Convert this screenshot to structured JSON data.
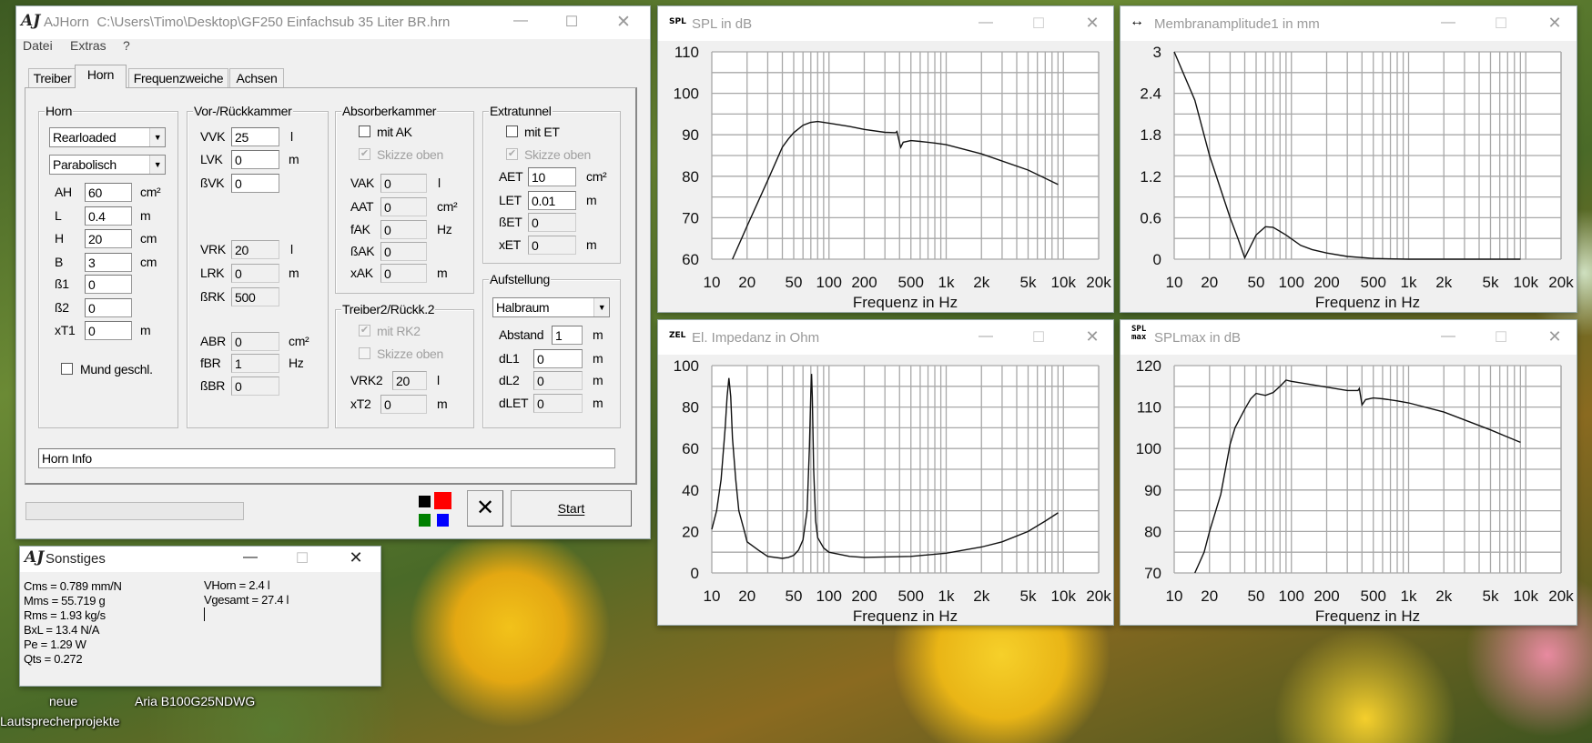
{
  "desktop_icons": [
    "neue",
    "Lautsprecherprojekte",
    "Aria B100G25NDWG"
  ],
  "main": {
    "title": "AJHorn  C:\\Users\\Timo\\Desktop\\GF250 Einfachsub 35 Liter BR.hrn",
    "logo": "AJ",
    "menu": [
      "Datei",
      "Extras",
      "?"
    ],
    "tabs": [
      "Treiber",
      "Horn",
      "Frequenzweiche",
      "Achsen"
    ],
    "active_tab": "Horn",
    "horn": {
      "title": "Horn",
      "type": "Rearloaded",
      "profile": "Parabolisch",
      "fields": [
        {
          "label": "AH",
          "value": "60",
          "unit": "cm²"
        },
        {
          "label": "L",
          "value": "0.4",
          "unit": "m"
        },
        {
          "label": "H",
          "value": "20",
          "unit": "cm"
        },
        {
          "label": "B",
          "value": "3",
          "unit": "cm"
        },
        {
          "label": "ß1",
          "value": "0",
          "unit": ""
        },
        {
          "label": "ß2",
          "value": "0",
          "unit": ""
        },
        {
          "label": "xT1",
          "value": "0",
          "unit": "m"
        }
      ],
      "mund_label": "Mund geschl.",
      "mund_checked": false
    },
    "vor": {
      "title": "Vor-/Rückkammer",
      "fields": [
        {
          "label": "VVK",
          "value": "25",
          "unit": "l"
        },
        {
          "label": "LVK",
          "value": "0",
          "unit": "m"
        },
        {
          "label": "ßVK",
          "value": "0",
          "unit": ""
        },
        {
          "label": "VRK",
          "value": "20",
          "unit": "l"
        },
        {
          "label": "LRK",
          "value": "0",
          "unit": "m"
        },
        {
          "label": "ßRK",
          "value": "500",
          "unit": ""
        },
        {
          "label": "ABR",
          "value": "0",
          "unit": "cm²"
        },
        {
          "label": "fBR",
          "value": "1",
          "unit": "Hz"
        },
        {
          "label": "ßBR",
          "value": "0",
          "unit": ""
        }
      ]
    },
    "absorber": {
      "title": "Absorberkammer",
      "check1": "mit AK",
      "check1_checked": false,
      "check2": "Skizze oben",
      "check2_checked": true,
      "fields": [
        {
          "label": "VAK",
          "value": "0",
          "unit": "l"
        },
        {
          "label": "AAT",
          "value": "0",
          "unit": "cm²"
        },
        {
          "label": "fAK",
          "value": "0",
          "unit": "Hz"
        },
        {
          "label": "ßAK",
          "value": "0",
          "unit": ""
        },
        {
          "label": "xAK",
          "value": "0",
          "unit": "m"
        }
      ]
    },
    "treiber2": {
      "title": "Treiber2/Rückk.2",
      "check1": "mit RK2",
      "check1_checked": true,
      "check2": "Skizze oben",
      "check2_checked": false,
      "fields": [
        {
          "label": "VRK2",
          "value": "20",
          "unit": "l"
        },
        {
          "label": "xT2",
          "value": "0",
          "unit": "m"
        }
      ]
    },
    "extratunnel": {
      "title": "Extratunnel",
      "check1": "mit ET",
      "check1_checked": false,
      "check2": "Skizze oben",
      "check2_checked": true,
      "fields": [
        {
          "label": "AET",
          "value": "10",
          "unit": "cm²"
        },
        {
          "label": "LET",
          "value": "0.01",
          "unit": "m"
        },
        {
          "label": "ßET",
          "value": "0",
          "unit": ""
        },
        {
          "label": "xET",
          "value": "0",
          "unit": "m"
        }
      ]
    },
    "aufstellung": {
      "title": "Aufstellung",
      "mode": "Halbraum",
      "fields": [
        {
          "label": "Abstand",
          "value": "1",
          "unit": "m"
        },
        {
          "label": "dL1",
          "value": "0",
          "unit": "m"
        },
        {
          "label": "dL2",
          "value": "0",
          "unit": "m"
        },
        {
          "label": "dLET",
          "value": "0",
          "unit": "m"
        }
      ]
    },
    "horn_info": "Horn Info",
    "progress": 0,
    "colors": [
      "#000000",
      "#ff0000",
      "#008000",
      "#0000ff"
    ],
    "start_label": "Start",
    "cancel_glyph": "✕"
  },
  "sonstiges": {
    "title": "Sonstiges",
    "left": [
      "Cms = 0.789 mm/N",
      "Mms = 55.719 g",
      "Rms = 1.93 kg/s",
      "BxL = 13.4 N/A",
      "Pe = 1.29 W",
      "Qts = 0.272"
    ],
    "right": [
      "VHorn = 2.4 l",
      "Vgesamt = 27.4 l"
    ]
  },
  "chart_data": [
    {
      "type": "line",
      "title": "SPL in dB",
      "icon": "SPL",
      "xlabel": "Frequenz in Hz",
      "ylabel": "SPL in dB",
      "xscale": "log",
      "xlim": [
        10,
        20000
      ],
      "ylim": [
        60,
        110
      ],
      "ystep": 5,
      "yticks": [
        60,
        70,
        80,
        90,
        100,
        110
      ],
      "ytick_labels": [
        "60",
        "70",
        "80",
        "90",
        "100",
        "110"
      ],
      "xticks": [
        10,
        20,
        50,
        100,
        200,
        500,
        1000,
        2000,
        5000,
        10000,
        20000
      ],
      "xtick_labels": [
        "10",
        "20",
        "50",
        "100",
        "200",
        "500",
        "1k",
        "2k",
        "5k",
        "10k",
        "20k"
      ],
      "grid": true,
      "x": [
        15,
        20,
        30,
        40,
        45,
        50,
        60,
        70,
        80,
        100,
        150,
        200,
        300,
        370,
        380,
        400,
        410,
        430,
        500,
        600,
        800,
        1000,
        2000,
        5000,
        9000
      ],
      "y": [
        60,
        68,
        79,
        87,
        89,
        90.5,
        92.3,
        93,
        93.2,
        92.8,
        92,
        91.3,
        90.6,
        90.5,
        90.8,
        88,
        87,
        88.2,
        88.6,
        88.4,
        88,
        87.6,
        85.4,
        81.5,
        78
      ]
    },
    {
      "type": "line",
      "title": "Membranamplitude1 in mm",
      "icon": "↔",
      "xlabel": "Frequenz in Hz",
      "ylabel": "Membranamplitude in mm",
      "xscale": "log",
      "xlim": [
        10,
        20000
      ],
      "ylim": [
        0,
        3
      ],
      "ystep": 0.3,
      "yticks": [
        0,
        0.6,
        1.2,
        1.8,
        2.4,
        3
      ],
      "ytick_labels": [
        "0",
        "0.6",
        "1.2",
        "1.8",
        "2.4",
        "3"
      ],
      "xticks": [
        10,
        20,
        50,
        100,
        200,
        500,
        1000,
        2000,
        5000,
        10000,
        20000
      ],
      "xtick_labels": [
        "10",
        "20",
        "50",
        "100",
        "200",
        "500",
        "1k",
        "2k",
        "5k",
        "10k",
        "20k"
      ],
      "grid": true,
      "x": [
        10,
        15,
        20,
        30,
        35,
        40,
        50,
        60,
        70,
        90,
        120,
        150,
        200,
        300,
        500,
        1000,
        9000
      ],
      "y": [
        3,
        2.3,
        1.5,
        0.6,
        0.3,
        0.02,
        0.35,
        0.47,
        0.46,
        0.35,
        0.2,
        0.14,
        0.09,
        0.04,
        0.01,
        0,
        0
      ]
    },
    {
      "type": "line",
      "title": "El. Impedanz in Ohm",
      "icon": "ZEL",
      "xlabel": "Frequenz in Hz",
      "ylabel": "Impedanz in Ohm",
      "xscale": "log",
      "xlim": [
        10,
        20000
      ],
      "ylim": [
        0,
        100
      ],
      "ystep": 10,
      "yticks": [
        0,
        20,
        40,
        60,
        80,
        100
      ],
      "ytick_labels": [
        "0",
        "20",
        "40",
        "60",
        "80",
        "100"
      ],
      "xticks": [
        10,
        20,
        50,
        100,
        200,
        500,
        1000,
        2000,
        5000,
        10000,
        20000
      ],
      "xtick_labels": [
        "10",
        "20",
        "50",
        "100",
        "200",
        "500",
        "1k",
        "2k",
        "5k",
        "10k",
        "20k"
      ],
      "grid": true,
      "x": [
        10,
        11,
        12,
        13,
        13.5,
        14,
        14.5,
        15,
        16,
        17,
        19,
        20,
        25,
        30,
        40,
        45,
        50,
        55,
        60,
        65,
        68,
        70,
        71,
        72,
        74,
        77,
        80,
        90,
        100,
        150,
        200,
        500,
        1000,
        2000,
        3000,
        5000,
        7000,
        9000
      ],
      "y": [
        21,
        30,
        45,
        70,
        85,
        94,
        85,
        65,
        45,
        30,
        20,
        15,
        11,
        8,
        7,
        7.5,
        8.5,
        11,
        16,
        30,
        60,
        87,
        96,
        85,
        50,
        25,
        17,
        12,
        10,
        8,
        7.5,
        8,
        9.5,
        12.5,
        15,
        20,
        25,
        29
      ]
    },
    {
      "type": "line",
      "title": "SPLmax in dB",
      "icon": "SPL max",
      "xlabel": "Frequenz in Hz",
      "ylabel": "SPLmax in dB",
      "xscale": "log",
      "xlim": [
        10,
        20000
      ],
      "ylim": [
        70,
        120
      ],
      "ystep": 5,
      "yticks": [
        70,
        80,
        90,
        100,
        110,
        120
      ],
      "ytick_labels": [
        "70",
        "80",
        "90",
        "100",
        "110",
        "120"
      ],
      "xticks": [
        10,
        20,
        50,
        100,
        200,
        500,
        1000,
        2000,
        5000,
        10000,
        20000
      ],
      "xtick_labels": [
        "10",
        "20",
        "50",
        "100",
        "200",
        "500",
        "1k",
        "2k",
        "5k",
        "10k",
        "20k"
      ],
      "grid": true,
      "x": [
        15,
        18,
        20,
        25,
        30,
        33,
        40,
        45,
        50,
        60,
        70,
        80,
        90,
        100,
        200,
        300,
        370,
        380,
        400,
        430,
        500,
        600,
        800,
        1000,
        2000,
        5000,
        9000
      ],
      "y": [
        70,
        75,
        80,
        89,
        101,
        105,
        109.5,
        112,
        113.3,
        112.8,
        113.5,
        115,
        116.5,
        116.2,
        114.8,
        114,
        114,
        114.5,
        110.5,
        111.8,
        112.2,
        112,
        111.5,
        111,
        108.8,
        104.5,
        101.5
      ]
    }
  ]
}
